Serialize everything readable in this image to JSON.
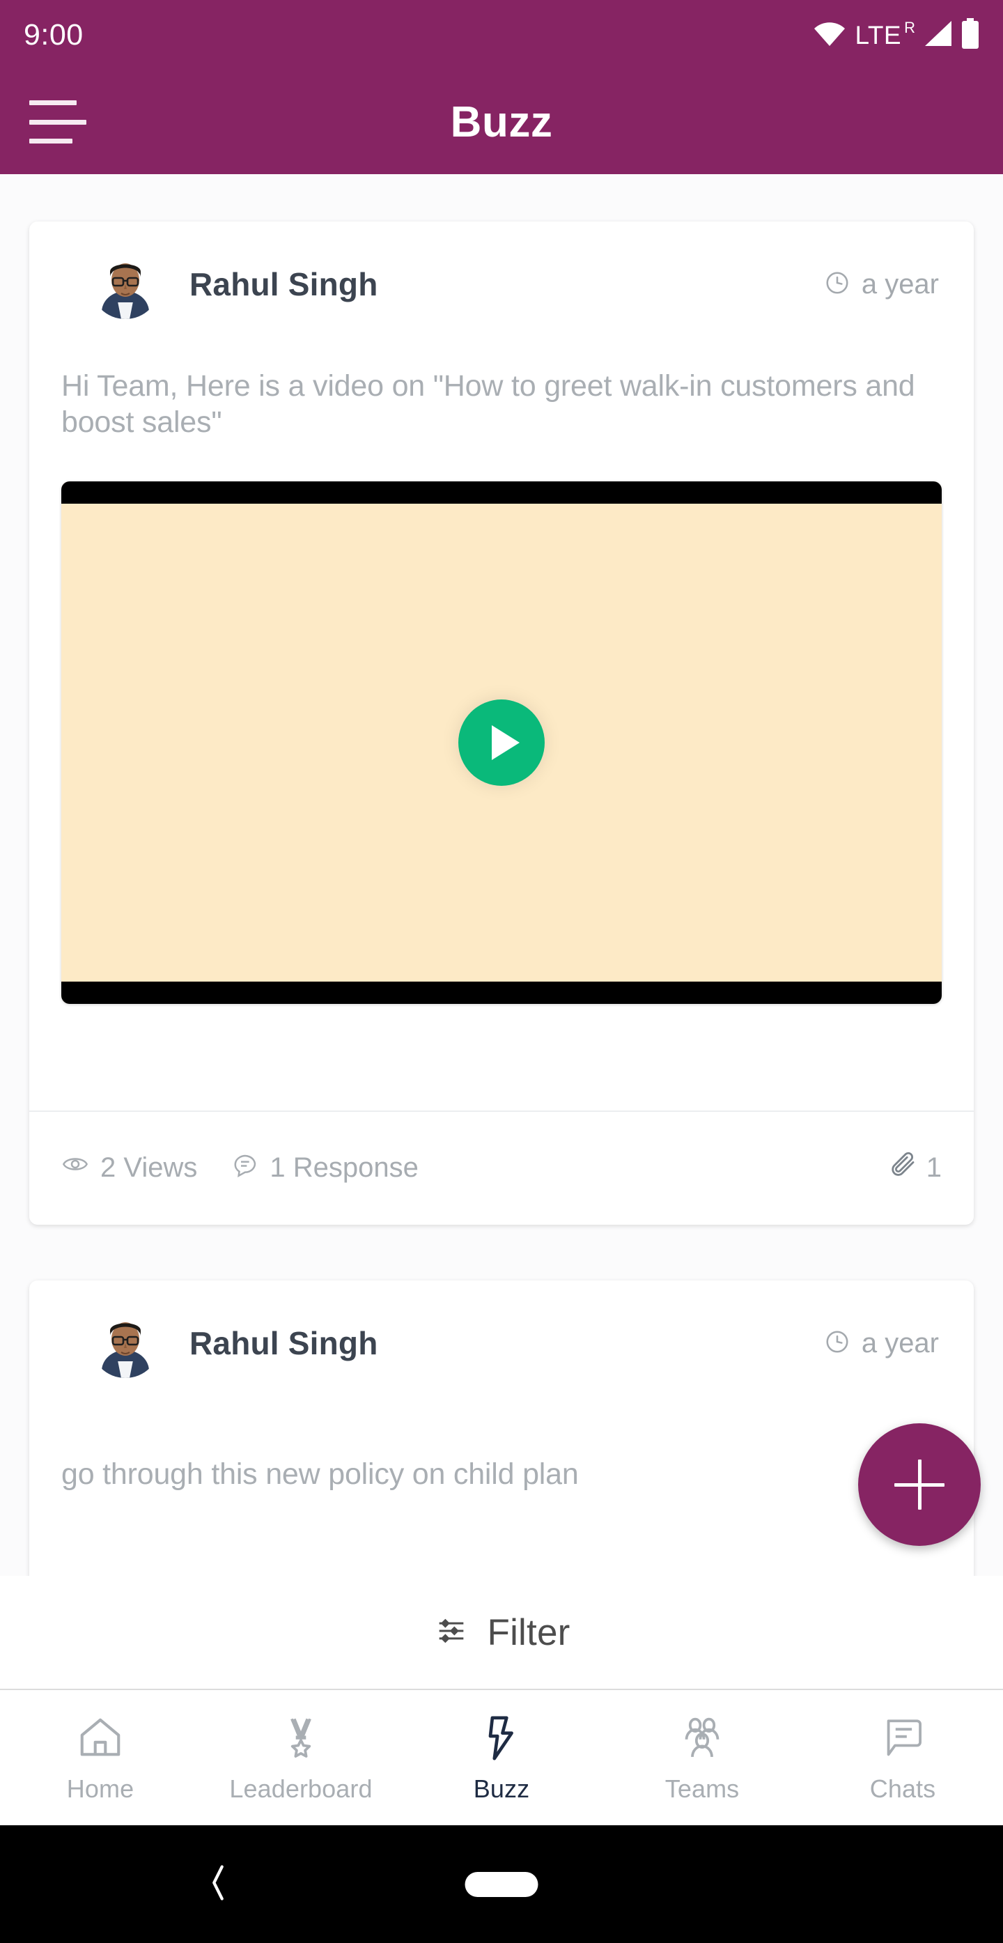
{
  "status_bar": {
    "clock": "9:00",
    "network_label": "LTE",
    "roaming_label": "R",
    "icons": [
      "wifi-icon",
      "signal-icon",
      "battery-icon"
    ]
  },
  "app_bar": {
    "title": "Buzz",
    "menu_icon": "hamburger-menu-icon",
    "background_color": "#862463"
  },
  "feed": {
    "posts": [
      {
        "author": "Rahul Singh",
        "timestamp": "a year",
        "time_icon": "clock-icon",
        "body": "Hi Team, Here is a video on \"How to greet walk-in customers and boost sales\"",
        "media": {
          "type": "video",
          "play_icon": "play-icon",
          "play_color": "#0ab97a",
          "thumbnail_color": "#fdeac6"
        },
        "views": "2 Views",
        "views_icon": "eye-icon",
        "responses": "1 Response",
        "responses_icon": "comment-icon",
        "attachments": "1",
        "attachments_icon": "paperclip-icon"
      },
      {
        "author": "Rahul Singh",
        "timestamp": "a year",
        "time_icon": "clock-icon",
        "body": "go through this  new policy on child plan"
      }
    ]
  },
  "fab": {
    "label": "+",
    "icon": "plus-icon",
    "color": "#862463"
  },
  "filter": {
    "label": "Filter",
    "icon": "sliders-icon"
  },
  "bottom_nav": {
    "active": "Buzz",
    "items": [
      {
        "label": "Home",
        "icon": "home-icon"
      },
      {
        "label": "Leaderboard",
        "icon": "medal-icon"
      },
      {
        "label": "Buzz",
        "icon": "lightning-bolt-icon"
      },
      {
        "label": "Teams",
        "icon": "people-icon"
      },
      {
        "label": "Chats",
        "icon": "chat-bubble-icon"
      }
    ]
  },
  "system_nav": {
    "back_icon": "back-chevron-icon",
    "home_icon": "home-pill-icon"
  }
}
